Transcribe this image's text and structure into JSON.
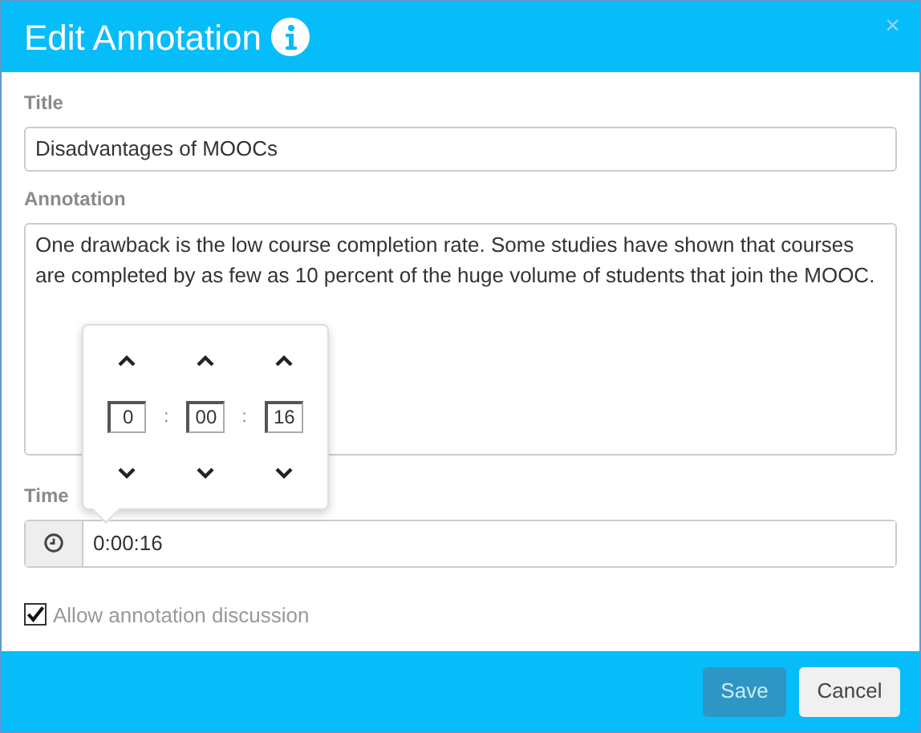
{
  "dialog": {
    "title": "Edit Annotation",
    "close": "×"
  },
  "title_field": {
    "label": "Title",
    "value": "Disadvantages of MOOCs"
  },
  "annotation_field": {
    "label": "Annotation",
    "value": "One drawback is the low course completion rate. Some studies have shown that courses are completed by as few as 10 percent of the huge volume of students that join the MOOC."
  },
  "time_picker": {
    "open": true,
    "fields": [
      {
        "value": "0"
      },
      {
        "value": "00"
      },
      {
        "value": "16"
      }
    ],
    "separators": [
      ":",
      ":"
    ]
  },
  "time_field": {
    "label": "Time",
    "value": "0:00:16"
  },
  "discussion": {
    "label": "Allow annotation discussion",
    "checked": true
  },
  "buttons": [
    {
      "label": "Save",
      "kind": "primary"
    },
    {
      "label": "Cancel",
      "kind": "secondary"
    }
  ]
}
